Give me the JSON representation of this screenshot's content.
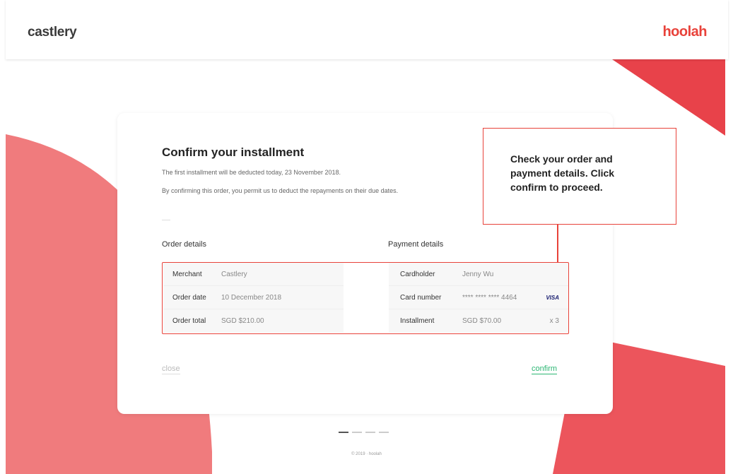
{
  "header": {
    "brand": "castlery",
    "logo": "hoolah"
  },
  "card": {
    "title": "Confirm your installment",
    "line1": "The first installment will be deducted today, 23 November 2018.",
    "line2": "By confirming this order, you permit us to deduct the repayments on their due dates.",
    "order": {
      "heading": "Order details",
      "rows": [
        {
          "label": "Merchant",
          "value": "Castlery"
        },
        {
          "label": "Order date",
          "value": "10 December 2018"
        },
        {
          "label": "Order total",
          "value": "SGD $210.00"
        }
      ]
    },
    "payment": {
      "heading": "Payment details",
      "rows": [
        {
          "label": "Cardholder",
          "value": "Jenny Wu"
        },
        {
          "label": "Card number",
          "value": "**** **** **** 4464",
          "badge": "VISA"
        },
        {
          "label": "Installment",
          "value": "SGD $70.00",
          "badge": "x 3"
        }
      ]
    },
    "close_label": "close",
    "confirm_label": "confirm"
  },
  "callout": {
    "text": "Check your order and payment details.  Click confirm to proceed."
  },
  "pagination": {
    "total": 4,
    "active": 1
  },
  "footer": "© 2019 · hoolah",
  "colors": {
    "brand": "#e8423a",
    "confirm": "#2bb673",
    "visa": "#1a1f71"
  }
}
